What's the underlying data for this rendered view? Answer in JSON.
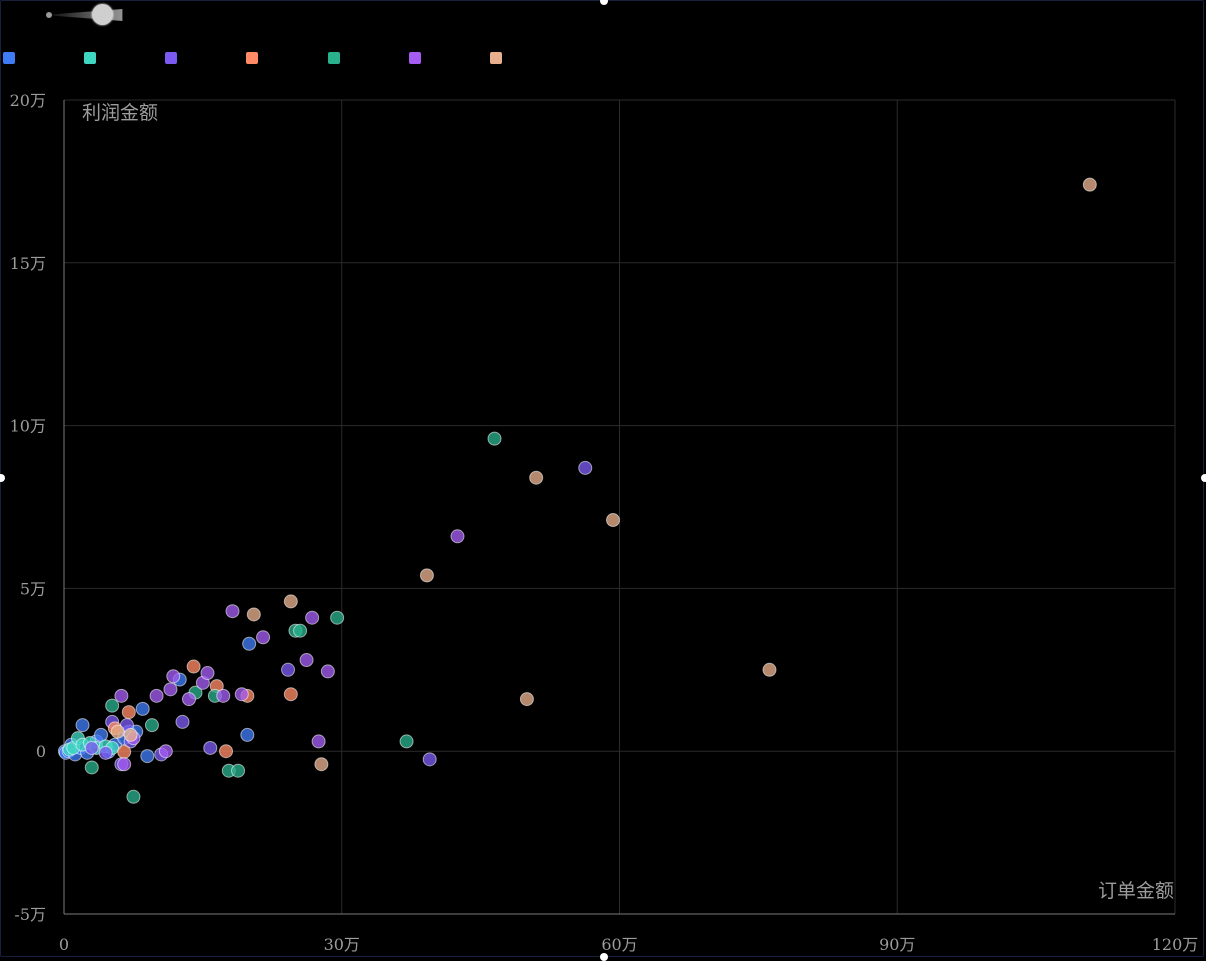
{
  "chart_data": {
    "type": "scatter",
    "xlabel": "订单金额",
    "ylabel": "利润金额",
    "xlim": [
      0,
      1200000
    ],
    "ylim": [
      -50000,
      200000
    ],
    "x_ticks": [
      0,
      300000,
      600000,
      900000,
      1200000
    ],
    "x_tick_labels": [
      "0",
      "30万",
      "60万",
      "90万",
      "120万"
    ],
    "y_ticks": [
      -50000,
      0,
      50000,
      100000,
      150000,
      200000
    ],
    "y_tick_labels": [
      "-5万",
      "0",
      "5万",
      "10万",
      "15万",
      "20万"
    ],
    "grid": true,
    "legend_position": "top-left",
    "series": [
      {
        "color": "#3f7bf5",
        "points": [
          [
            1000,
            0
          ],
          [
            2000,
            -500
          ],
          [
            5000,
            0
          ],
          [
            8000,
            2000
          ],
          [
            12000,
            -1000
          ],
          [
            18000,
            1000
          ],
          [
            20000,
            8000
          ],
          [
            25000,
            -500
          ],
          [
            35000,
            3000
          ],
          [
            40000,
            5000
          ],
          [
            48000,
            -200
          ],
          [
            55000,
            2000
          ],
          [
            65000,
            4000
          ],
          [
            70000,
            6000
          ],
          [
            78000,
            6000
          ],
          [
            85000,
            13000
          ],
          [
            90000,
            -1500
          ],
          [
            125000,
            22000
          ],
          [
            198000,
            5000
          ],
          [
            200000,
            33000
          ]
        ]
      },
      {
        "color": "#3fd6c2",
        "points": [
          [
            6000,
            500
          ],
          [
            10000,
            1000
          ],
          [
            15000,
            4000
          ],
          [
            20000,
            2000
          ],
          [
            28000,
            2500
          ],
          [
            35000,
            1000
          ],
          [
            45000,
            1500
          ],
          [
            52000,
            1000
          ]
        ]
      },
      {
        "color": "#7a5af0",
        "points": [
          [
            30000,
            1000
          ],
          [
            45000,
            -500
          ],
          [
            52000,
            9000
          ],
          [
            62000,
            -4000
          ],
          [
            68000,
            8000
          ],
          [
            72000,
            3000
          ],
          [
            105000,
            -1000
          ],
          [
            128000,
            9000
          ],
          [
            158000,
            1000
          ],
          [
            242000,
            25000
          ],
          [
            395000,
            -2500
          ],
          [
            563000,
            87000
          ]
        ]
      },
      {
        "color": "#ff8a65",
        "points": [
          [
            55000,
            7000
          ],
          [
            65000,
            -200
          ],
          [
            70000,
            12000
          ],
          [
            140000,
            26000
          ],
          [
            165000,
            20000
          ],
          [
            175000,
            0
          ],
          [
            198000,
            17000
          ],
          [
            245000,
            17500
          ]
        ]
      },
      {
        "color": "#29b08c",
        "points": [
          [
            30000,
            -5000
          ],
          [
            52000,
            14000
          ],
          [
            75000,
            -14000
          ],
          [
            95000,
            8000
          ],
          [
            142000,
            18000
          ],
          [
            163000,
            17000
          ],
          [
            178000,
            -6000
          ],
          [
            188000,
            -6000
          ],
          [
            250000,
            37000
          ],
          [
            255000,
            37000
          ],
          [
            295000,
            41000
          ],
          [
            370000,
            3000
          ],
          [
            465000,
            96000
          ]
        ]
      },
      {
        "color": "#a45cf2",
        "points": [
          [
            62000,
            17000
          ],
          [
            65000,
            -4000
          ],
          [
            75000,
            4000
          ],
          [
            100000,
            17000
          ],
          [
            110000,
            0
          ],
          [
            115000,
            19000
          ],
          [
            118000,
            23000
          ],
          [
            135000,
            16000
          ],
          [
            150000,
            21000
          ],
          [
            155000,
            24000
          ],
          [
            172000,
            17000
          ],
          [
            182000,
            43000
          ],
          [
            192000,
            17500
          ],
          [
            215000,
            35000
          ],
          [
            262000,
            28000
          ],
          [
            268000,
            41000
          ],
          [
            275000,
            3000
          ],
          [
            285000,
            24500
          ],
          [
            425000,
            66000
          ]
        ]
      },
      {
        "color": "#e8b08c",
        "points": [
          [
            58000,
            6000
          ],
          [
            72000,
            5000
          ],
          [
            205000,
            42000
          ],
          [
            245000,
            46000
          ],
          [
            278000,
            -4000
          ],
          [
            392000,
            54000
          ],
          [
            500000,
            16000
          ],
          [
            510000,
            84000
          ],
          [
            593000,
            71000
          ],
          [
            762000,
            25000
          ],
          [
            1108000,
            174000
          ]
        ]
      }
    ]
  }
}
